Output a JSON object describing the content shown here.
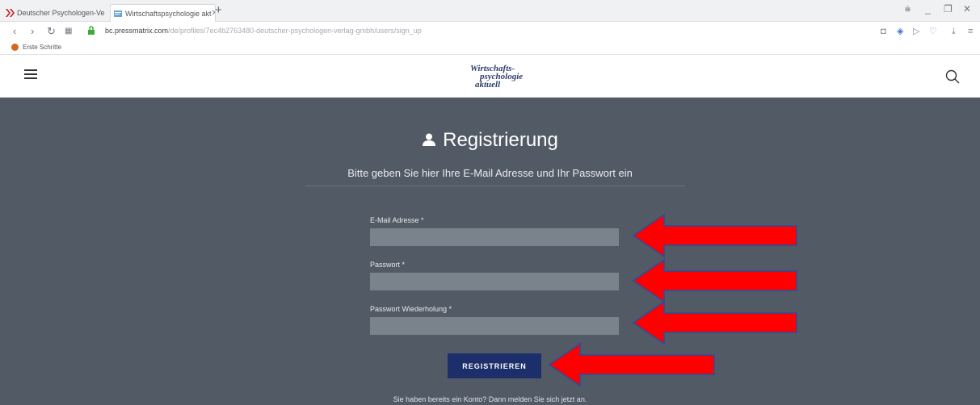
{
  "browser": {
    "tabs": [
      {
        "label": "Deutscher Psychologen-Ve",
        "active": false
      },
      {
        "label": "Wirtschaftspsychologie akt",
        "active": true
      }
    ],
    "url_domain": "bc.pressmatrix.com",
    "url_path": "/de/profiles/7ec4b2763480-deutscher-psychologen-verlag-gmbh/users/sign_up",
    "bookmark": "Erste Schritte"
  },
  "site": {
    "logo_lines": [
      "Wirtschafts-",
      "psychologie",
      "aktuell"
    ]
  },
  "form": {
    "title": "Registrierung",
    "subtitle": "Bitte geben Sie hier Ihre E-Mail Adresse und Ihr Passwort ein",
    "fields": [
      {
        "label": "E-Mail Adresse *",
        "value": ""
      },
      {
        "label": "Passwort *",
        "value": ""
      },
      {
        "label": "Passwort Wiederholung *",
        "value": ""
      }
    ],
    "submit_label": "REGISTRIEREN",
    "footer_text": "Sie haben bereits ein Konto? Dann melden Sie sich jetzt an."
  },
  "colors": {
    "page_bg": "#525a65",
    "input_bg": "#7a828c",
    "button_bg": "#1c2f6b",
    "annotation_arrow": "#ff0000"
  }
}
